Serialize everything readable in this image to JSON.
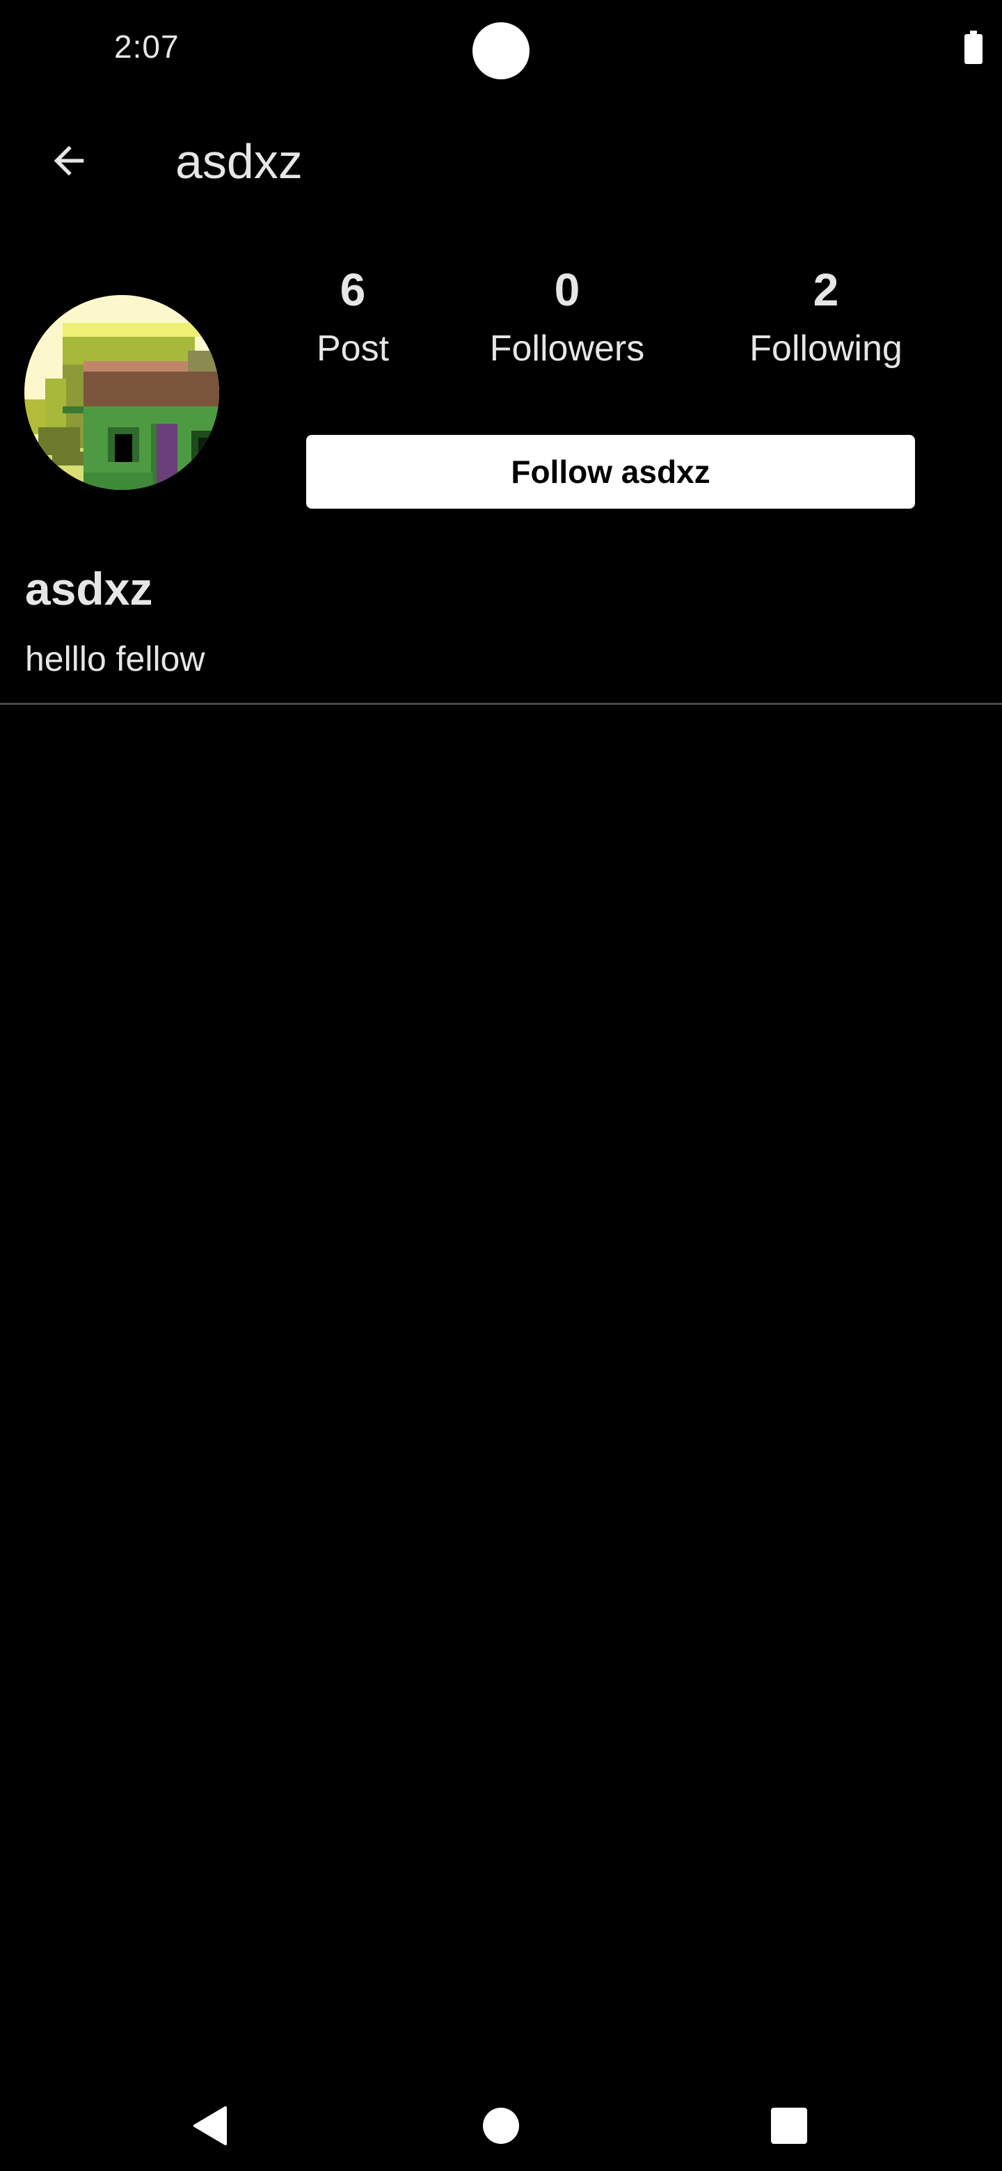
{
  "status_bar": {
    "time": "2:07",
    "battery_icon": "battery-full-icon"
  },
  "app_bar": {
    "back_icon": "arrow-left-icon",
    "title": "asdxz"
  },
  "profile": {
    "avatar_icon": "pixel-art-avatar",
    "stats": {
      "posts_value": "6",
      "posts_label": "Post",
      "followers_value": "0",
      "followers_label": "Followers",
      "following_value": "2",
      "following_label": "Following"
    },
    "follow_button_label": "Follow asdxz",
    "name": "asdxz",
    "bio": "helllo fellow"
  },
  "nav_bar": {
    "back_icon": "nav-back-triangle-icon",
    "home_icon": "nav-home-circle-icon",
    "recents_icon": "nav-recents-square-icon"
  },
  "colors": {
    "background": "#000000",
    "text": "#e6e6e6",
    "button_bg": "#ffffff",
    "divider": "#4a4a4a"
  }
}
